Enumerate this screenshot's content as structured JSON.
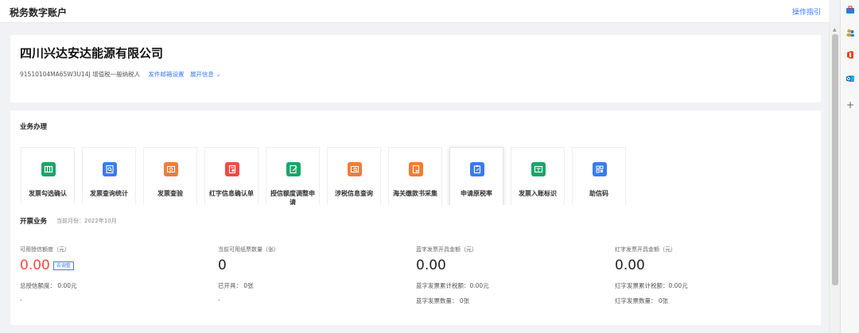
{
  "header": {
    "title": "税务数字账户",
    "guide_link": "操作指引"
  },
  "company": {
    "name": "四川兴达安达能源有限公司",
    "tax_id": "91510104MA65W3U14J",
    "taxpayer_type": "增值税一般纳税人",
    "email_settings": "发件邮箱设置",
    "expand": "展开信息 ⌄"
  },
  "business": {
    "title": "业务办理",
    "items": [
      {
        "label": "发票勾选确认",
        "icon": "ticket-icon",
        "color": "#1aa56a"
      },
      {
        "label": "发票查询统计",
        "icon": "invoice-search-icon",
        "color": "#3a7bf0"
      },
      {
        "label": "发票查验",
        "icon": "ticket-check-icon",
        "color": "#f27c35"
      },
      {
        "label": "红字信息确认单",
        "icon": "red-note-icon",
        "color": "#f04b45"
      },
      {
        "label": "授信额度调整申请",
        "icon": "edit-doc-icon",
        "color": "#1aa56a"
      },
      {
        "label": "涉税信息查询",
        "icon": "tax-search-icon",
        "color": "#f27c35"
      },
      {
        "label": "海关缴款书采集",
        "icon": "customs-doc-icon",
        "color": "#f27c35"
      },
      {
        "label": "申请原税率",
        "icon": "clipboard-edit-icon",
        "color": "#3a7bf0"
      },
      {
        "label": "发票入账标识",
        "icon": "ledger-icon",
        "color": "#1aa56a"
      },
      {
        "label": "助信码",
        "icon": "code-icon",
        "color": "#3a7bf0"
      }
    ]
  },
  "issuing": {
    "title": "开票业务",
    "current_month": "当前月份：2022年10月",
    "adjust_button": "去调整",
    "stats": [
      {
        "label": "可用授信额度（元）",
        "value": "0.00",
        "line1": "总授信额度：  0.00元",
        "line2": "-"
      },
      {
        "label": "当前可用纸票数量（张）",
        "value": "0",
        "line1": "已开具：  0张",
        "line2": "-"
      },
      {
        "label": "蓝字发票开具金额（元）",
        "value": "0.00",
        "line1": "蓝字发票累计税额：0.00元",
        "line2": "蓝字发票数量：  0张"
      },
      {
        "label": "红字发票开具金额（元）",
        "value": "0.00",
        "line1": "红字发票累计税额：0.00元",
        "line2": "红字发票数量：  0张"
      }
    ]
  },
  "colors": {
    "accent": "#3a7bf0",
    "alert": "#f04b45",
    "green": "#1aa56a",
    "orange": "#f27c35"
  }
}
